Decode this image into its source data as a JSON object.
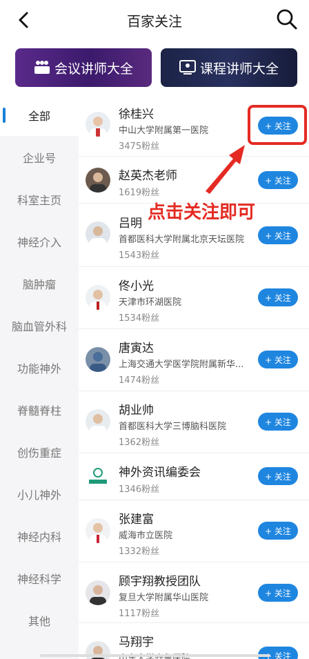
{
  "header": {
    "title": "百家关注"
  },
  "banners": [
    {
      "label": "会议讲师大全",
      "icon": "meeting-icon"
    },
    {
      "label": "课程讲师大全",
      "icon": "screen-icon"
    }
  ],
  "sidebar": {
    "items": [
      {
        "label": "全部",
        "active": true
      },
      {
        "label": "企业号"
      },
      {
        "label": "科室主页"
      },
      {
        "label": "神经介入"
      },
      {
        "label": "脑肿瘤"
      },
      {
        "label": "脑血管外科"
      },
      {
        "label": "功能神外"
      },
      {
        "label": "脊髓脊柱"
      },
      {
        "label": "创伤重症"
      },
      {
        "label": "小儿神外"
      },
      {
        "label": "神经内科"
      },
      {
        "label": "神经科学"
      },
      {
        "label": "其他"
      }
    ]
  },
  "list": {
    "follow_label": "+ 关注",
    "rows": [
      {
        "name": "徐桂兴",
        "org": "中山大学附属第一医院",
        "fans": "3475粉丝"
      },
      {
        "name": "赵英杰老师",
        "org": "",
        "fans": "1619粉丝"
      },
      {
        "name": "吕明",
        "org": "首都医科大学附属北京天坛医院",
        "fans": "1543粉丝"
      },
      {
        "name": "佟小光",
        "org": "天津市环湖医院",
        "fans": "1534粉丝"
      },
      {
        "name": "唐寅达",
        "org": "上海交通大学医学院附属新华...",
        "fans": "1474粉丝"
      },
      {
        "name": "胡业帅",
        "org": "首都医科大学三博脑科医院",
        "fans": "1362粉丝"
      },
      {
        "name": "神外资讯编委会",
        "org": "",
        "fans": "1346粉丝"
      },
      {
        "name": "张建富",
        "org": "威海市立医院",
        "fans": "1332粉丝"
      },
      {
        "name": "顾宇翔教授团队",
        "org": "复旦大学附属华山医院",
        "fans": "1117粉丝"
      },
      {
        "name": "马翔宇",
        "org": "山东大学齐鲁医院",
        "fans": ""
      }
    ]
  },
  "annotation": {
    "text": "点击关注即可",
    "color": "#e42a22"
  },
  "colors": {
    "accent": "#1f86e0",
    "sidebar_bg": "#f5f5f7"
  }
}
